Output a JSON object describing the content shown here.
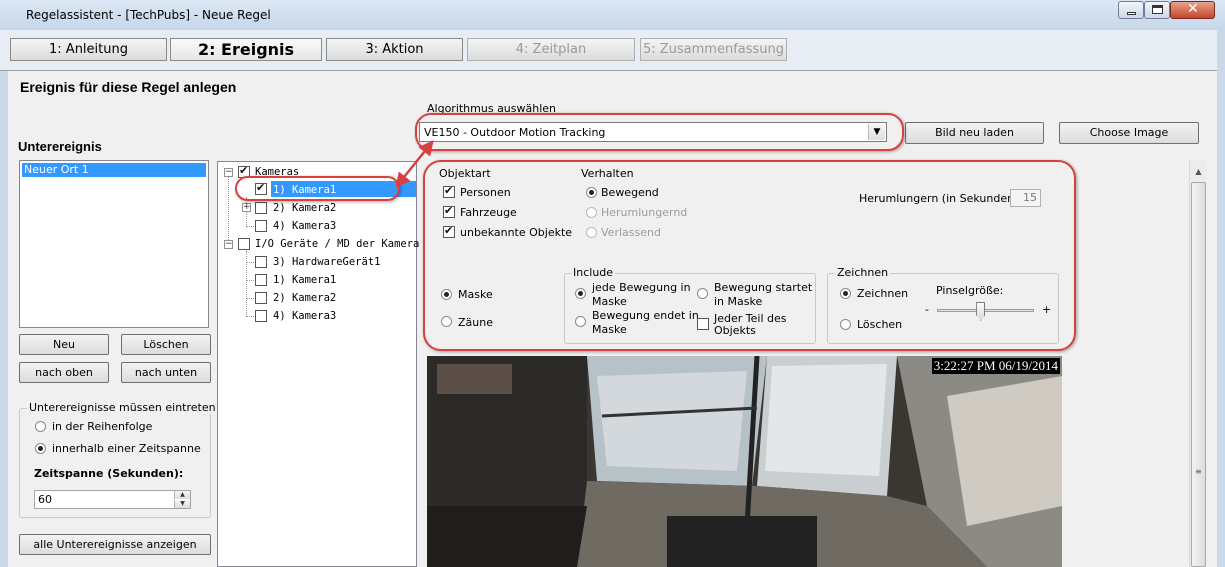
{
  "window": {
    "title": "Regelassistent - [TechPubs] - Neue Regel"
  },
  "tabs": [
    {
      "label": "1: Anleitung"
    },
    {
      "label": "2: Ereignis"
    },
    {
      "label": "3: Aktion"
    },
    {
      "label": "4: Zeitplan"
    },
    {
      "label": "5: Zusammenfassung"
    }
  ],
  "page": {
    "title": "Ereignis für diese Regel anlegen"
  },
  "sub_events": {
    "heading": "Unterereignis",
    "items": [
      "Neuer Ort 1"
    ],
    "buttons": {
      "new": "Neu",
      "delete": "Löschen",
      "up": "nach oben",
      "down": "nach unten"
    },
    "occurrence_group": {
      "title": "Unterereignisse müssen eintreten",
      "option_order": "in der Reihenfolge",
      "option_timespan": "innerhalb einer Zeitspanne",
      "timespan_label": "Zeitspanne (Sekunden):",
      "timespan_value": "60"
    },
    "show_all_button": "alle Unterereignisse anzeigen"
  },
  "tree": {
    "cameras": "Kameras",
    "camera1": "1) Kamera1",
    "camera2": "2) Kamera2",
    "camera3": "4) Kamera3",
    "io_devices": "I/O Geräte / MD der Kamera",
    "hardware1": "3) HardwareGerät1",
    "io_camera1": "1) Kamera1",
    "io_camera2": "2) Kamera2",
    "io_camera3": "4) Kamera3"
  },
  "algorithm": {
    "label": "Algorithmus auswählen",
    "selected": "VE150 - Outdoor Motion Tracking",
    "reload_button": "Bild neu laden",
    "choose_image_button": "Choose Image"
  },
  "object_type": {
    "title": "Objektart",
    "persons": "Personen",
    "vehicles": "Fahrzeuge",
    "unknown": "unbekannte Objekte"
  },
  "behavior": {
    "title": "Verhalten",
    "moving": "Bewegend",
    "loitering": "Herumlungernd",
    "leaving": "Verlassend",
    "loiter_label": "Herumlungern (in Sekunden)",
    "loiter_value": "15"
  },
  "mask": {
    "mask": "Maske",
    "fences": "Zäune"
  },
  "include": {
    "title": "Include",
    "any_motion": "jede Bewegung in Maske",
    "motion_starts": "Bewegung startet in Maske",
    "motion_ends": "Bewegung endet in Maske",
    "any_part": "Jeder Teil des Objekts"
  },
  "draw": {
    "title": "Zeichnen",
    "draw": "Zeichnen",
    "erase": "Löschen",
    "brush_label": "Pinselgröße:",
    "brush_level": 0.45,
    "minus": "-",
    "plus": "+"
  },
  "video": {
    "timestamp": "3:22:27 PM 06/19/2014"
  },
  "colors": {
    "annotation": "#d84040",
    "selection": "#3399ff"
  }
}
